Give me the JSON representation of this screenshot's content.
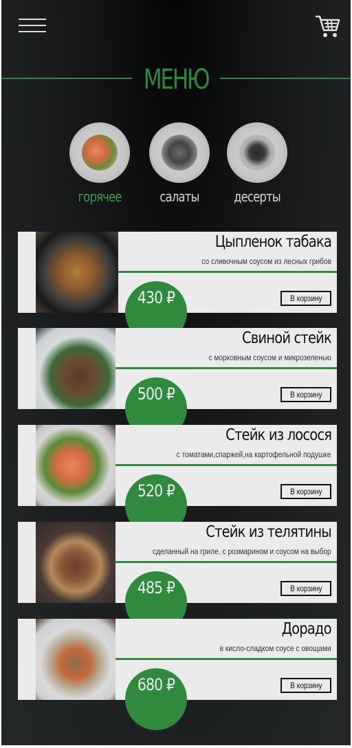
{
  "header": {
    "title": "МЕНЮ",
    "menu_icon": "hamburger-icon",
    "cart_icon": "cart-icon"
  },
  "categories": [
    {
      "label": "горячее",
      "active": true
    },
    {
      "label": "салаты",
      "active": false
    },
    {
      "label": "десерты",
      "active": false
    }
  ],
  "dishes": [
    {
      "name": "Цыпленок табака",
      "description": "со сливочным соусом из лесных грибов",
      "price": "430 ₽",
      "button": "В корзину"
    },
    {
      "name": "Свиной стейк",
      "description": "с морковным соусом и микрозеленью",
      "price": "500 ₽",
      "button": "В корзину"
    },
    {
      "name": "Стейк из лосося",
      "description": "с томатами,спаржей,на картофельной подушке",
      "price": "520 ₽",
      "button": "В корзину"
    },
    {
      "name": "Стейк из телятины",
      "description": "сделанный на гриле, с розмарином и соусом на выбор",
      "price": "485 ₽",
      "button": "В корзину"
    },
    {
      "name": "Дорадо",
      "description": "в кисло-сладком соусе с овощами",
      "price": "680 ₽",
      "button": "В корзину"
    }
  ],
  "colors": {
    "accent": "#2f8a3e",
    "active_category": "#3e9a4e",
    "card_bg": "#ebebeb",
    "background": "#1e2122"
  }
}
